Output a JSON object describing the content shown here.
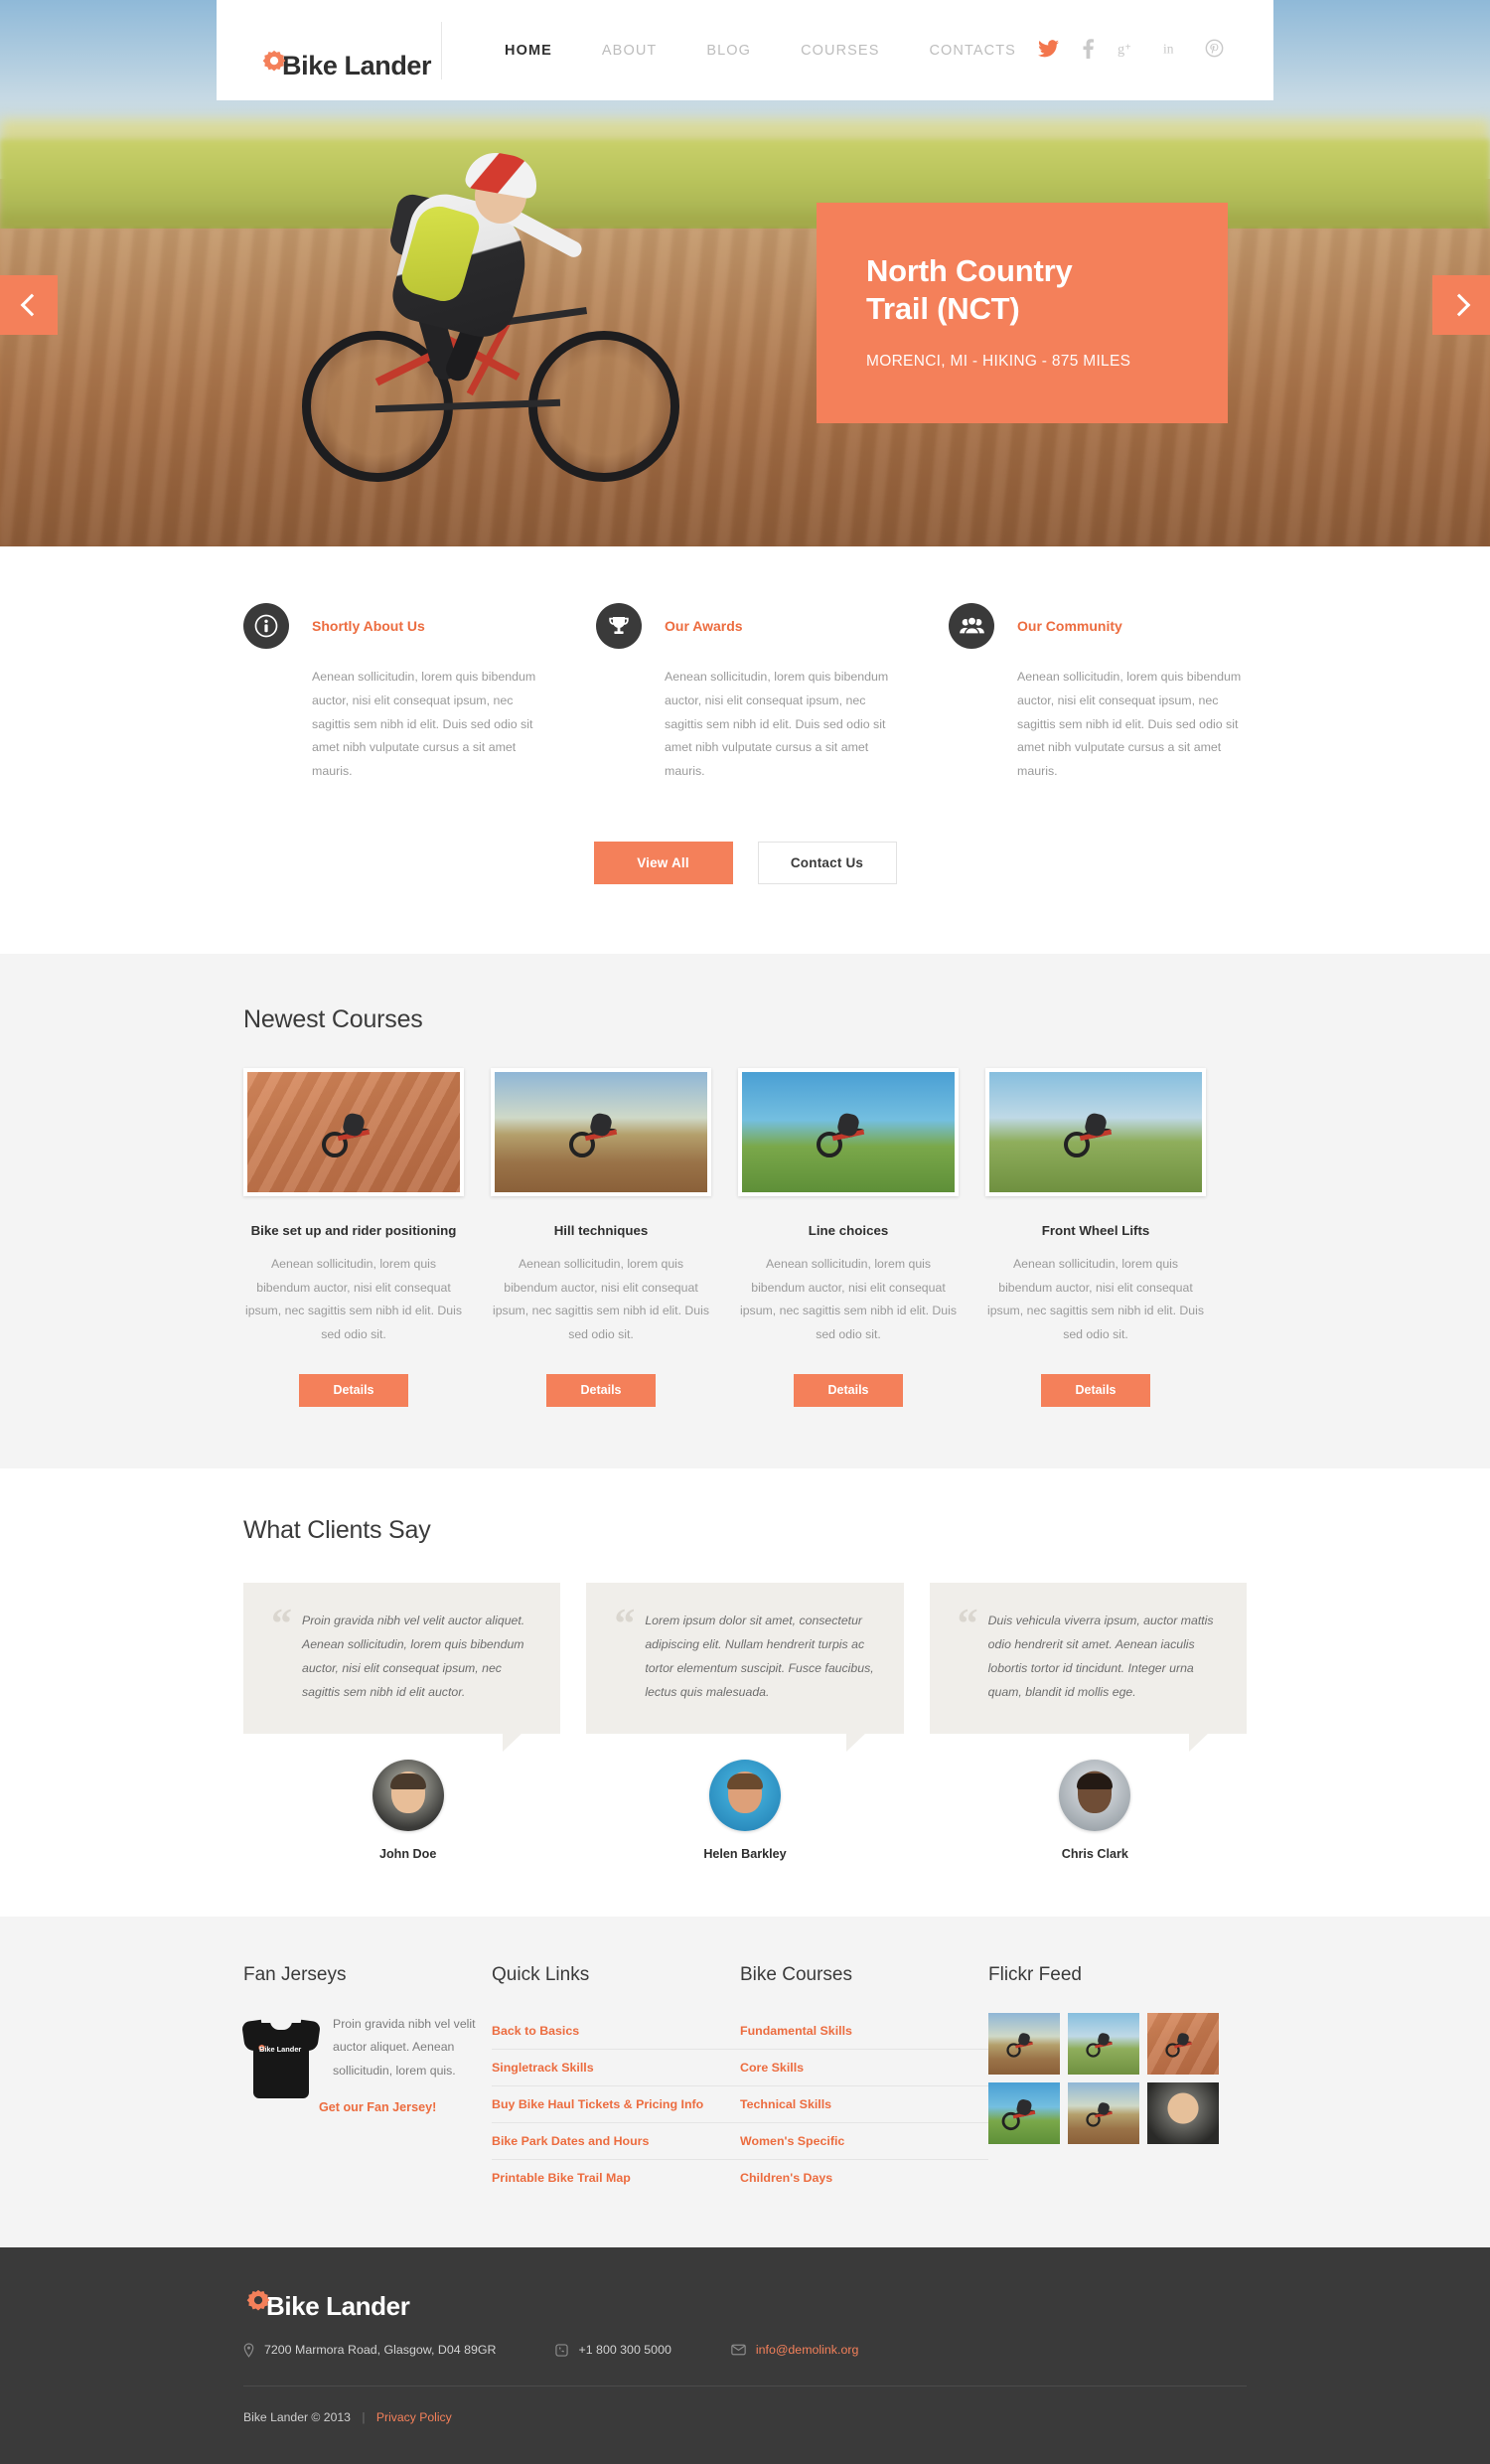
{
  "brand": {
    "name": "Bike Lander",
    "logo_icon": "gear-icon"
  },
  "nav": {
    "items": [
      {
        "label": "HOME",
        "active": true
      },
      {
        "label": "ABOUT",
        "active": false
      },
      {
        "label": "BLOG",
        "active": false
      },
      {
        "label": "COURSES",
        "active": false
      },
      {
        "label": "CONTACTS",
        "active": false
      }
    ],
    "socials": [
      {
        "name": "twitter-icon",
        "glyph": "ᴠ"
      },
      {
        "name": "facebook-icon",
        "glyph": "f"
      },
      {
        "name": "googleplus-icon",
        "glyph": "g⁺"
      },
      {
        "name": "linkedin-icon",
        "glyph": "in"
      },
      {
        "name": "pinterest-icon",
        "glyph": "Ⓟ"
      }
    ]
  },
  "hero": {
    "title_line1": "North Country",
    "title_line2": "Trail (NCT)",
    "subtitle": "MORENCI, MI - HIKING - 875 MILES",
    "prev_label": "Previous slide",
    "next_label": "Next slide",
    "accent": "#f4805a"
  },
  "features": [
    {
      "icon": "info-icon",
      "title": "Shortly About Us",
      "text": "Aenean sollicitudin, lorem quis bibendum auctor, nisi elit consequat ipsum, nec sagittis sem nibh id elit. Duis sed odio sit amet nibh vulputate cursus a sit amet mauris."
    },
    {
      "icon": "trophy-icon",
      "title": "Our Awards",
      "text": "Aenean sollicitudin, lorem quis bibendum auctor, nisi elit consequat ipsum, nec sagittis sem nibh id elit. Duis sed odio sit amet nibh vulputate cursus a sit amet mauris."
    },
    {
      "icon": "community-icon",
      "title": "Our Community",
      "text": "Aenean sollicitudin, lorem quis bibendum auctor, nisi elit consequat ipsum, nec sagittis sem nibh id elit. Duis sed odio sit amet nibh vulputate cursus a sit amet mauris."
    }
  ],
  "buttons": {
    "view_all": "View All",
    "contact_us": "Contact Us"
  },
  "courses_section": {
    "title": "Newest Courses",
    "details_label": "Details",
    "items": [
      {
        "name": "Bike set up and rider positioning",
        "text": "Aenean sollicitudin, lorem quis bibendum auctor, nisi elit consequat ipsum, nec sagittis sem nibh id elit. Duis sed odio sit.",
        "image": "rider-on-red-dirt-slope"
      },
      {
        "name": "Hill techniques",
        "text": "Aenean sollicitudin, lorem quis bibendum auctor, nisi elit consequat ipsum, nec sagittis sem nibh id elit. Duis sed odio sit.",
        "image": "rider-on-sunset-dirt-road"
      },
      {
        "name": "Line choices",
        "text": "Aenean sollicitudin, lorem quis bibendum auctor, nisi elit consequat ipsum, nec sagittis sem nibh id elit. Duis sed odio sit.",
        "image": "low-angle-bike-blue-sky"
      },
      {
        "name": "Front Wheel Lifts",
        "text": "Aenean sollicitudin, lorem quis bibendum auctor, nisi elit consequat ipsum, nec sagittis sem nibh id elit. Duis sed odio sit.",
        "image": "rider-with-red-backpack"
      }
    ]
  },
  "testimonials_section": {
    "title": "What Clients Say",
    "items": [
      {
        "text": "Proin gravida nibh vel velit auctor aliquet. Aenean sollicitudin, lorem quis bibendum auctor, nisi elit consequat ipsum, nec sagittis sem nibh id elit auctor.",
        "author": "John Doe",
        "avatar": "avatar-john-doe"
      },
      {
        "text": "Lorem ipsum dolor sit amet, consectetur adipiscing elit. Nullam hendrerit turpis ac tortor elementum suscipit. Fusce faucibus, lectus quis malesuada.",
        "author": "Helen Barkley",
        "avatar": "avatar-helen-barkley"
      },
      {
        "text": "Duis vehicula viverra ipsum, auctor mattis odio hendrerit sit amet. Aenean iaculis lobortis tortor id tincidunt. Integer urna quam, blandit id mollis ege.",
        "author": "Chris Clark",
        "avatar": "avatar-chris-clark"
      }
    ]
  },
  "footer_widgets": {
    "jersey": {
      "title": "Fan Jerseys",
      "text": "Proin gravida nibh vel velit auctor aliquet. Aenean sollicitudin, lorem quis.",
      "link": "Get our Fan Jersey!",
      "shirt_logo": "Bike Lander"
    },
    "quick_links": {
      "title": "Quick Links",
      "items": [
        "Back to Basics",
        "Singletrack Skills",
        "Buy Bike Haul Tickets & Pricing Info",
        "Bike Park Dates and Hours",
        "Printable Bike Trail Map"
      ]
    },
    "bike_courses": {
      "title": "Bike Courses",
      "items": [
        "Fundamental Skills",
        "Core Skills",
        "Technical Skills",
        "Women's Specific",
        "Children's Days"
      ]
    },
    "flickr": {
      "title": "Flickr Feed",
      "items": [
        "rider-on-sunset-dirt-road",
        "rider-with-red-backpack",
        "rider-on-red-dirt-slope",
        "low-angle-wheel-blue-bike",
        "rider-yellow-field",
        "portrait-man-face"
      ]
    }
  },
  "dark_footer": {
    "brand": "Bike Lander",
    "address": "7200  Marmora Road, Glasgow, D04 89GR",
    "phone": "+1 800 300 5000",
    "email": "info@demolink.org",
    "copyright": "Bike Lander © 2013",
    "separator": "|",
    "privacy": "Privacy Policy"
  }
}
